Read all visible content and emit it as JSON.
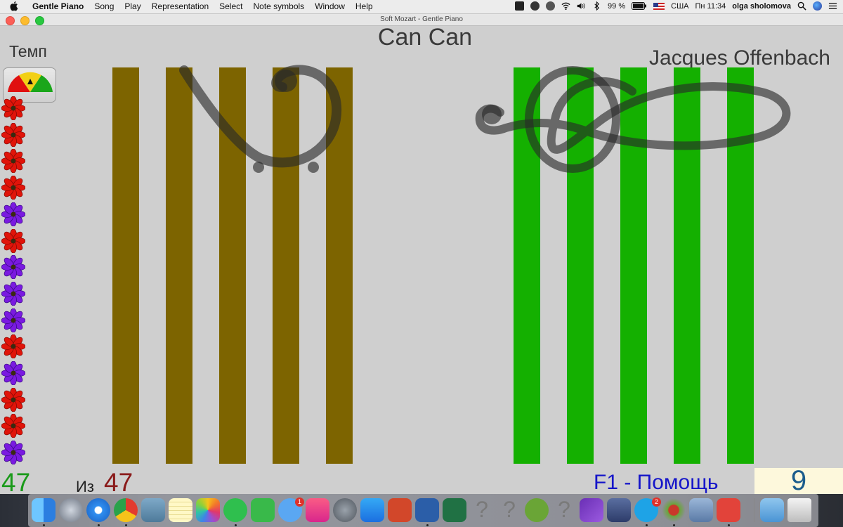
{
  "menubar": {
    "app_name": "Gentle Piano",
    "items": [
      "Song",
      "Play",
      "Representation",
      "Select",
      "Note symbols",
      "Window",
      "Help"
    ],
    "battery": "99 %",
    "input_source": "США",
    "clock": "Пн 11:34",
    "user": "olga sholomova"
  },
  "window": {
    "title": "Soft Mozart - Gentle Piano"
  },
  "song": {
    "title": "Can Can",
    "composer": "Jacques Offenbach"
  },
  "tempo": {
    "label": "Темп"
  },
  "flowers": [
    "red",
    "red",
    "red",
    "red",
    "purple",
    "red",
    "purple",
    "purple",
    "purple",
    "red",
    "purple",
    "red",
    "red",
    "purple"
  ],
  "staff": {
    "bass_bar_color": "#7d6400",
    "treble_bar_color": "#14b000"
  },
  "footer": {
    "notes_played": "47",
    "of_label": "Из",
    "notes_total": "47",
    "help": "F1 - Помощь",
    "score": "9"
  },
  "dock": {
    "apps": [
      "finder-icon",
      "launchpad-icon",
      "safari-icon",
      "chrome-icon",
      "preview-icon",
      "notes-icon",
      "photos-icon",
      "whatsapp-icon",
      "facetime-icon",
      "messages-icon",
      "music-icon",
      "system-preferences-icon",
      "app-store-icon",
      "powerpoint-icon",
      "word-icon",
      "excel-icon",
      "unknown-app-icon",
      "unknown-app-icon",
      "utorrent-icon",
      "unknown-app-icon",
      "visual-studio-icon",
      "remote-desktop-icon",
      "skype-icon",
      "music-app-icon",
      "image-capture-icon",
      "anydesk-icon",
      "downloads-folder-icon",
      "trash-icon"
    ],
    "messages_badge": "1",
    "skype_badge": "2"
  }
}
